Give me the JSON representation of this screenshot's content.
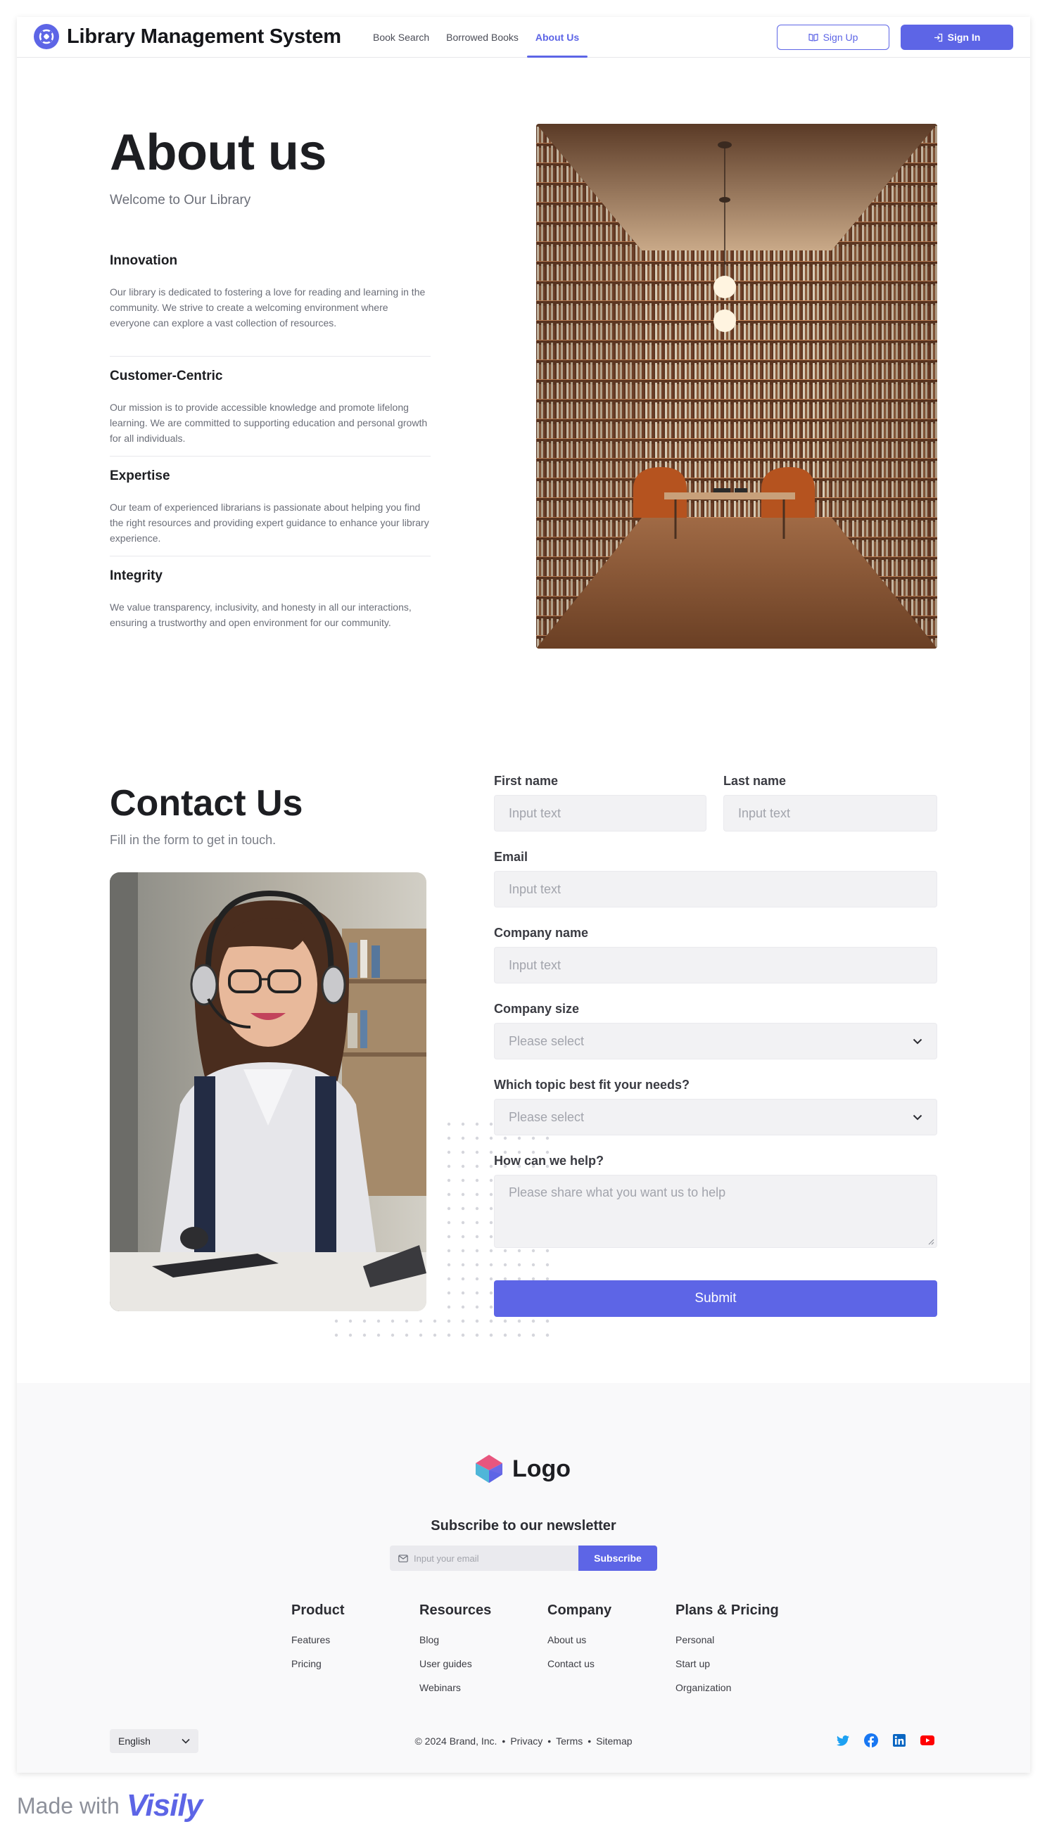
{
  "header": {
    "title": "Library Management System",
    "nav": [
      {
        "label": "Book Search",
        "active": false
      },
      {
        "label": "Borrowed Books",
        "active": false
      },
      {
        "label": "About Us",
        "active": true
      }
    ],
    "sign_up": "Sign Up",
    "sign_in": "Sign In"
  },
  "about": {
    "title": "About us",
    "subtitle": "Welcome to Our Library",
    "values": [
      {
        "title": "Innovation",
        "text": "Our library is dedicated to fostering a love for reading and learning in the community. We strive to create a welcoming environment where everyone can explore a vast collection of resources."
      },
      {
        "title": "Customer-Centric",
        "text": "Our mission is to provide accessible knowledge and promote lifelong learning. We are committed to supporting education and personal growth for all individuals."
      },
      {
        "title": "Expertise",
        "text": "Our team of experienced librarians is passionate about helping you find the right resources and providing expert guidance to enhance your library experience."
      },
      {
        "title": "Integrity",
        "text": "We value transparency, inclusivity, and honesty in all our interactions, ensuring a trustworthy and open environment for our community."
      }
    ]
  },
  "contact": {
    "title": "Contact Us",
    "subtitle": "Fill in the form to get in touch.",
    "fields": {
      "first_name": {
        "label": "First name",
        "placeholder": "Input text"
      },
      "last_name": {
        "label": "Last name",
        "placeholder": "Input text"
      },
      "email": {
        "label": "Email",
        "placeholder": "Input text"
      },
      "company_name": {
        "label": "Company name",
        "placeholder": "Input text"
      },
      "company_size": {
        "label": "Company size",
        "placeholder": "Please select"
      },
      "topic": {
        "label": "Which topic best fit your needs?",
        "placeholder": "Please select"
      },
      "help": {
        "label": "How can we help?",
        "placeholder": "Please share what you want us to help"
      }
    },
    "submit": "Submit"
  },
  "footer": {
    "logo_text": "Logo",
    "newsletter_title": "Subscribe to our newsletter",
    "newsletter_placeholder": "Input your email",
    "subscribe": "Subscribe",
    "columns": [
      {
        "title": "Product",
        "links": [
          "Features",
          "Pricing"
        ]
      },
      {
        "title": "Resources",
        "links": [
          "Blog",
          "User guides",
          "Webinars"
        ]
      },
      {
        "title": "Company",
        "links": [
          "About us",
          "Contact us"
        ]
      },
      {
        "title": "Plans & Pricing",
        "links": [
          "Personal",
          "Start up",
          "Organization"
        ]
      }
    ],
    "language": "English",
    "copyright": "© 2024 Brand, Inc.",
    "legal_links": [
      "Privacy",
      "Terms",
      "Sitemap"
    ],
    "social_icons": [
      "twitter-icon",
      "facebook-icon",
      "linkedin-icon",
      "youtube-icon"
    ]
  },
  "made_with": {
    "text": "Made with",
    "brand": "Visily"
  },
  "colors": {
    "accent": "#5d65e6",
    "text_dark": "#1d1e22",
    "text_muted": "#6b6e78",
    "input_bg": "#f2f2f4",
    "footer_bg": "#f9f9fa"
  }
}
